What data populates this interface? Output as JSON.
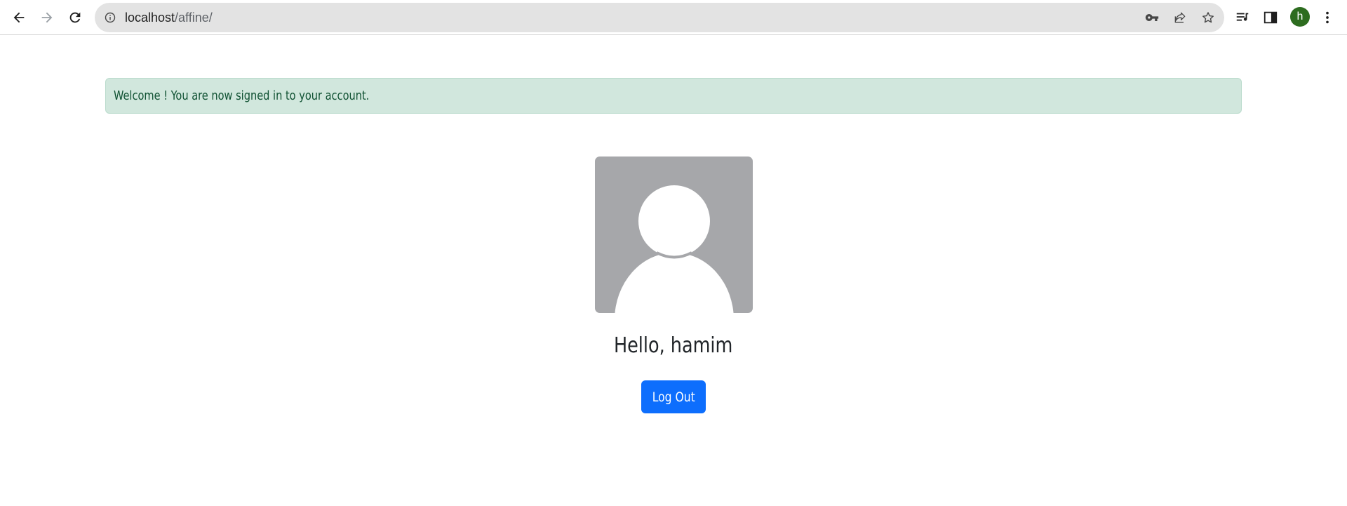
{
  "browser": {
    "address_bar": {
      "host": "localhost",
      "path": "/affine/"
    },
    "profile_initial": "h",
    "icons": {
      "back": "arrow-left-icon",
      "forward": "arrow-right-icon",
      "reload": "reload-icon",
      "site_info": "info-circle-icon",
      "password": "key-icon",
      "share": "share-icon",
      "bookmark": "star-icon",
      "media": "media-playlist-icon",
      "side_panel": "side-panel-icon",
      "menu": "kebab-menu-icon"
    }
  },
  "page": {
    "alert_message": "Welcome ! You are now signed in to your account.",
    "avatar_icon": "default-user-avatar-icon",
    "greeting": "Hello, hamim",
    "logout_label": "Log Out"
  },
  "colors": {
    "alert_background": "#d1e7dd",
    "alert_text": "#0f5132",
    "button_primary": "#0d6efd",
    "avatar_background": "#a6a7aa",
    "profile_avatar": "#2d6c1f"
  }
}
